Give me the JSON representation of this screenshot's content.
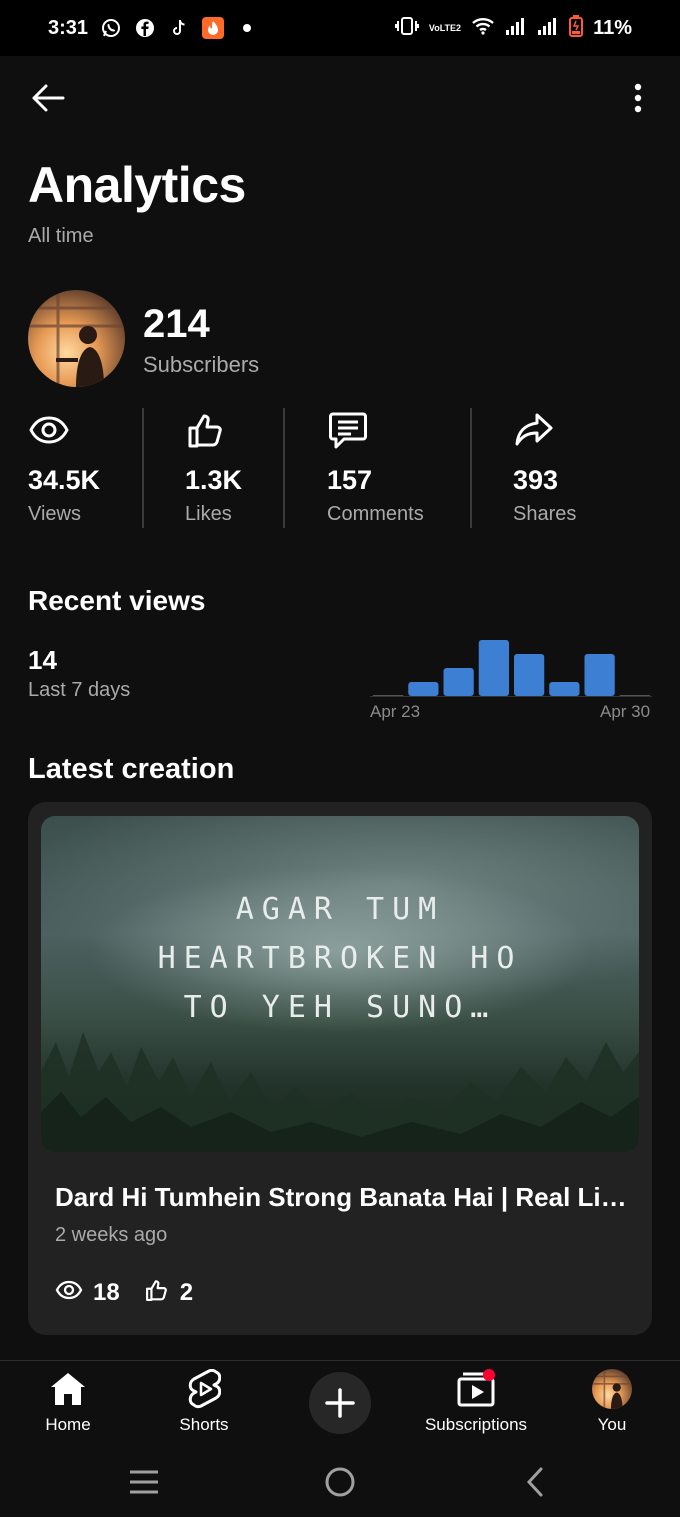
{
  "status_bar": {
    "time": "3:31",
    "left_icons": [
      "whatsapp-icon",
      "facebook-icon",
      "tiktok-icon",
      "app-icon",
      "dot-icon"
    ],
    "right_icons": [
      "vibrate-icon",
      "volte-icon",
      "wifi-icon",
      "signal-icon",
      "signal-icon",
      "battery-icon"
    ],
    "volte_text": "VoLTE2",
    "battery": "11%"
  },
  "header": {
    "title": "Analytics",
    "subtitle": "All time"
  },
  "channel": {
    "subscribers": "214",
    "subscribers_label": "Subscribers"
  },
  "stats": [
    {
      "icon": "eye-icon",
      "value": "34.5K",
      "label": "Views"
    },
    {
      "icon": "thumbs-up-icon",
      "value": "1.3K",
      "label": "Likes"
    },
    {
      "icon": "comment-icon",
      "value": "157",
      "label": "Comments"
    },
    {
      "icon": "share-icon",
      "value": "393",
      "label": "Shares"
    }
  ],
  "recent_views": {
    "heading": "Recent views",
    "value": "14",
    "period": "Last 7 days",
    "start_label": "Apr 23",
    "end_label": "Apr 30"
  },
  "chart_data": {
    "type": "bar",
    "categories": [
      "Apr 23",
      "",
      "",
      "",
      "",
      "",
      "",
      "Apr 30"
    ],
    "values": [
      0,
      1,
      2,
      4,
      3,
      1,
      3,
      0
    ],
    "title": "",
    "xlabel": "",
    "ylabel": "",
    "grid": false,
    "colors": {
      "bar": "#3d7fd2",
      "baseline": "#555555"
    }
  },
  "latest": {
    "heading": "Latest creation",
    "thumbnail_lines": [
      "AGAR TUM",
      "HEARTBROKEN HO",
      "TO YEH SUNO…"
    ],
    "title": "Dard Hi Tumhein Strong Banata Hai | Real Li…",
    "time": "2 weeks ago",
    "views": "18",
    "likes": "2"
  },
  "bottom_nav": {
    "home": "Home",
    "shorts": "Shorts",
    "subscriptions": "Subscriptions",
    "you": "You"
  },
  "colors": {
    "background": "#0f0f0f",
    "card": "#222222",
    "text_secondary": "#aaaaaa",
    "accent_bar": "#3d7fd2",
    "notification_dot": "#ff0033",
    "battery_icon": "#ff5a36"
  }
}
